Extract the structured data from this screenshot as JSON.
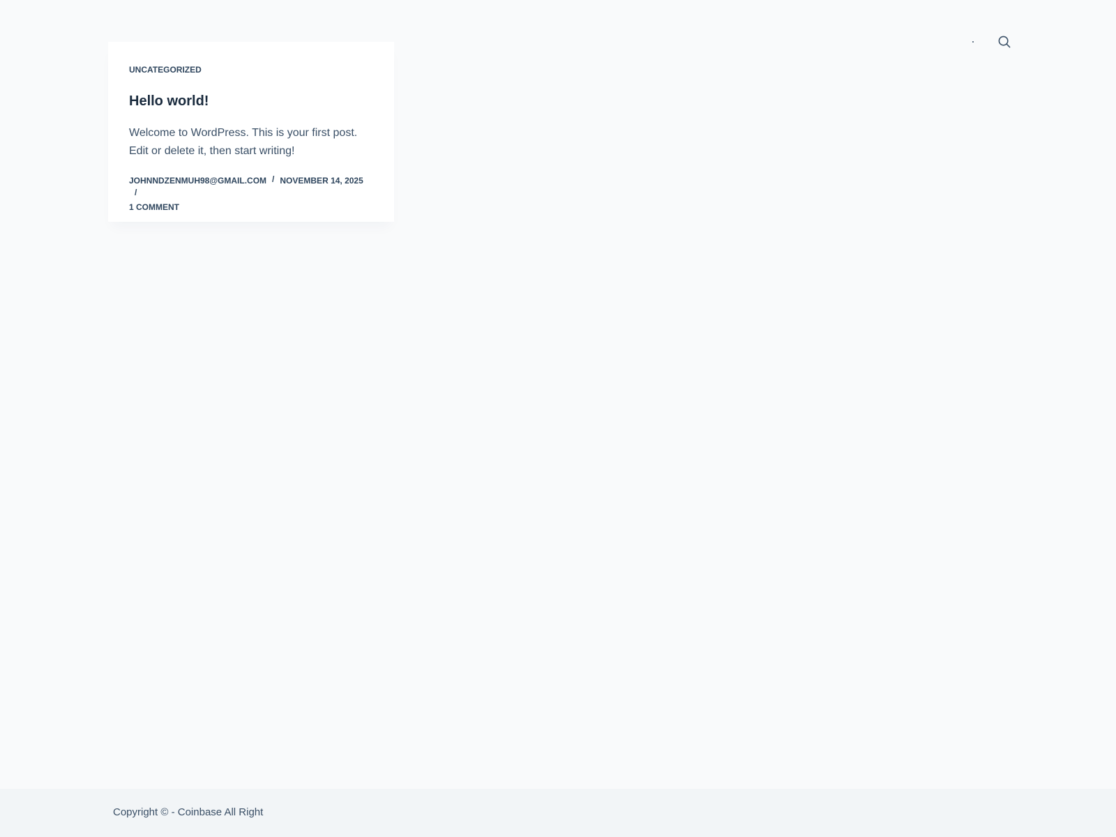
{
  "header": {
    "search_icon": "search-icon",
    "menu_trigger_icon": "dot-icon"
  },
  "post": {
    "category": "Uncategorized",
    "title": "Hello world!",
    "excerpt_line1": "Welcome to WordPress. This is your first post.",
    "excerpt_line2": "Edit or delete it, then start writing!",
    "author": "johnndzenmuh98@gmail.com",
    "date": "November 14, 2025",
    "comments": "1 Comment",
    "separator": "/"
  },
  "footer": {
    "copyright": "Copyright © - Coinbase All Right"
  },
  "colors": {
    "background": "#f9fafb",
    "card": "#ffffff",
    "title": "#192a3d",
    "text": "#3a4f66",
    "footer_bg": "#f2f5f7"
  }
}
